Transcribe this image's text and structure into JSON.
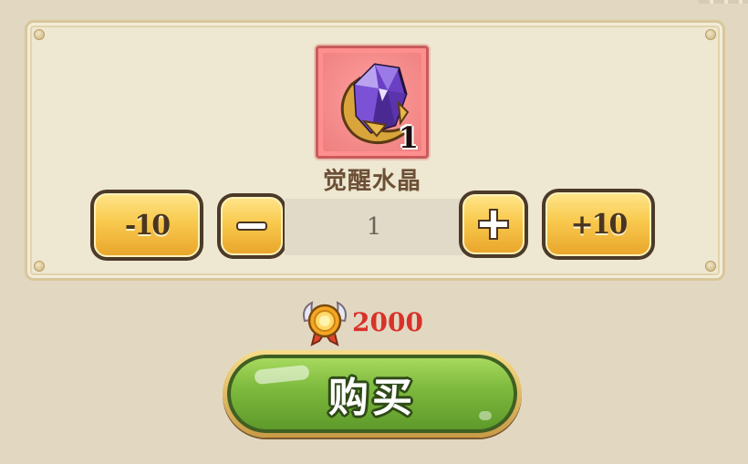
{
  "item": {
    "name": "觉醒水晶",
    "count": "1",
    "icon": "purple-crystal-icon",
    "frame_color": "#ff8f8f"
  },
  "quantity": {
    "minus10_label": "-10",
    "minus_icon": "minus-icon",
    "value": "1",
    "plus_icon": "plus-icon",
    "plus10_label": "+10"
  },
  "price": {
    "currency_icon": "gold-medal-icon",
    "amount": "2000",
    "amount_color": "#d8322a"
  },
  "buy_button": {
    "label": "购买",
    "color": "#7fbb3e"
  }
}
